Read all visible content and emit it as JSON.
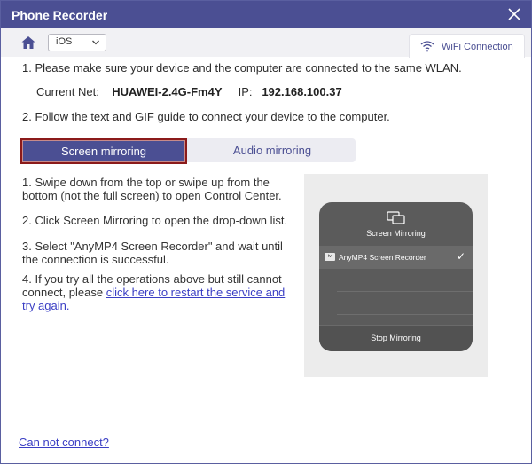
{
  "window": {
    "title": "Phone Recorder"
  },
  "toolbar": {
    "os_value": "iOS",
    "wifi_tab_label": "WiFi Connection"
  },
  "steps": {
    "step1": "1. Please make sure your device and the computer are connected to the same WLAN.",
    "net_label": "Current Net:",
    "net_value": "HUAWEI-2.4G-Fm4Y",
    "ip_label": "IP:",
    "ip_value": "192.168.100.37",
    "step2": "2. Follow the text and GIF guide to connect your device to the computer."
  },
  "tabs": [
    {
      "label": "Screen mirroring",
      "active": true
    },
    {
      "label": "Audio mirroring",
      "active": false
    }
  ],
  "instructions": {
    "i1": "1. Swipe down from the top or swipe up from the bottom (not the full screen) to open Control Center.",
    "i2": "2. Click Screen Mirroring to open the drop-down list.",
    "i3": "3. Select \"AnyMP4 Screen Recorder\" and wait until the connection is successful.",
    "i4_prefix": "4. If you try all the operations above but still cannot connect, please ",
    "i4_link": "click here to restart the service and try again."
  },
  "preview": {
    "title": "Screen Mirroring",
    "badge": "tv",
    "device": "AnyMP4 Screen Recorder",
    "check": "✓",
    "stop": "Stop Mirroring"
  },
  "footer": {
    "cannot_connect": "Can not connect?"
  },
  "colors": {
    "accent": "#4b4f93",
    "link": "#3a3ec4",
    "active_tab_border": "#8b1a1a"
  },
  "icons": {
    "home": "home-icon",
    "close": "close-icon",
    "wifi": "wifi-icon",
    "chevron": "chevron-down-icon",
    "mirror": "screen-mirroring-icon"
  }
}
